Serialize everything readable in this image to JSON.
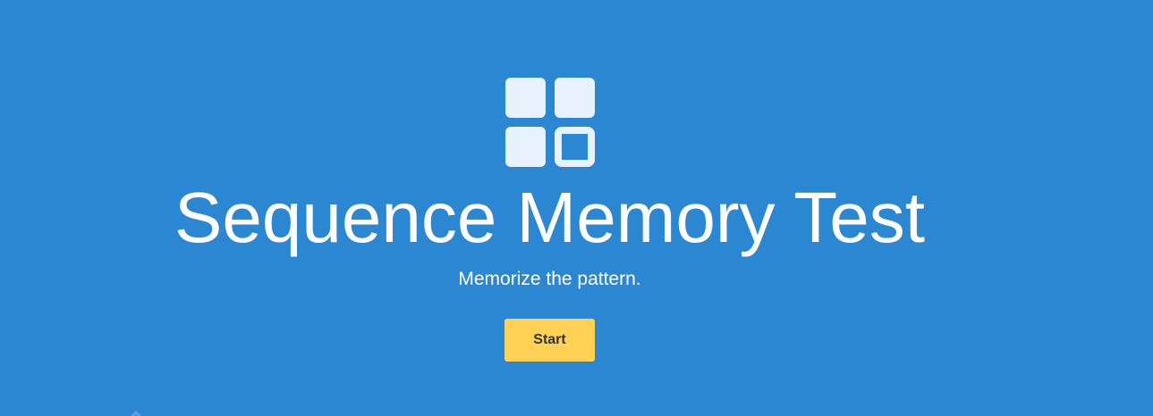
{
  "hero": {
    "title": "Sequence Memory Test",
    "subtitle": "Memorize the pattern.",
    "start_label": "Start",
    "logo_icon": "sequence-grid-icon"
  },
  "colors": {
    "background": "#2b87d1",
    "tile": "#e8f2fc",
    "button": "#ffd154",
    "button_text": "#333333"
  }
}
